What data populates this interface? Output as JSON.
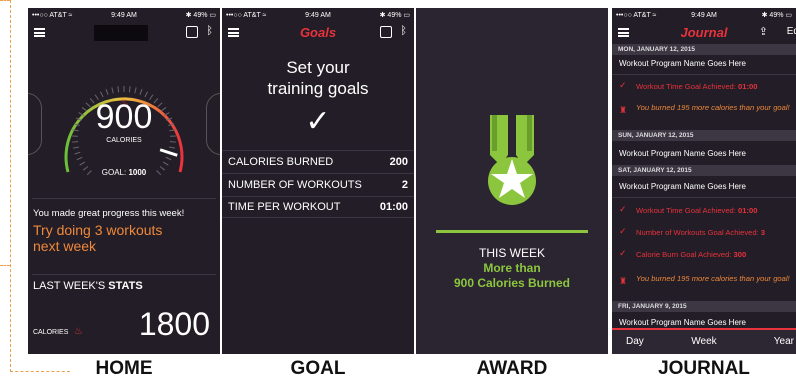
{
  "captions": [
    "HOME",
    "GOAL",
    "AWARD",
    "JOURNAL"
  ],
  "status": {
    "carrier": "•••○○ AT&T ≈",
    "time": "9:49 AM",
    "battery": "✱ 49% ▭"
  },
  "home": {
    "value": "900",
    "unit": "CALORIES",
    "goal_label": "GOAL:",
    "goal_value": "1000",
    "progress_text": "You made great progress this week!",
    "suggestion": "Try doing 3 workouts next week",
    "stats_prefix": "LAST WEEK'S ",
    "stats_bold": "STATS",
    "stat_label": "CALORIES",
    "stat_value": "1800",
    "progress_fraction": 0.9
  },
  "goal": {
    "nav_title": "Goals",
    "headline_1": "Set your",
    "headline_2": "training goals",
    "rows": [
      {
        "label": "CALORIES BURNED",
        "value": "200"
      },
      {
        "label": "NUMBER OF WORKOUTS",
        "value": "2"
      },
      {
        "label": "TIME PER WORKOUT",
        "value": "01:00"
      }
    ]
  },
  "award": {
    "line1": "THIS WEEK",
    "line2": "More than",
    "line3": "900 Calories Burned"
  },
  "journal": {
    "nav_title": "Journal",
    "edit_label": "Edit",
    "d1": "MON, JANUARY 12, 2015",
    "p1": "Workout Program Name Goes Here",
    "a1": "Workout Time Goal Achieved: ",
    "a1v": "01:00",
    "b1": "You burned 195 more calories than your goal!",
    "d2": "SUN, JANUARY 12, 2015",
    "p2": "Workout Program Name Goes Here",
    "d3": "SAT, JANUARY 12, 2015",
    "p3": "Workout Program Name Goes Here",
    "a2": "Workout Time Goal Achieved: ",
    "a2v": "01:00",
    "a3": "Number of Workouts Goal Achieved: ",
    "a3v": "3",
    "a4": "Calorie Burn Goal Achieved: ",
    "a4v": "300",
    "b2": "You burned 195 more calories than your goal!",
    "d4": "FRI, JANUARY 9, 2015",
    "p4": "Workout Program Name Goes Here",
    "tabs": [
      "Day",
      "Week",
      "Year"
    ]
  },
  "colors": {
    "background": "#221d26",
    "accent_red": "#e8323c",
    "accent_orange": "#f0883a",
    "award_green": "#8cc63f"
  }
}
